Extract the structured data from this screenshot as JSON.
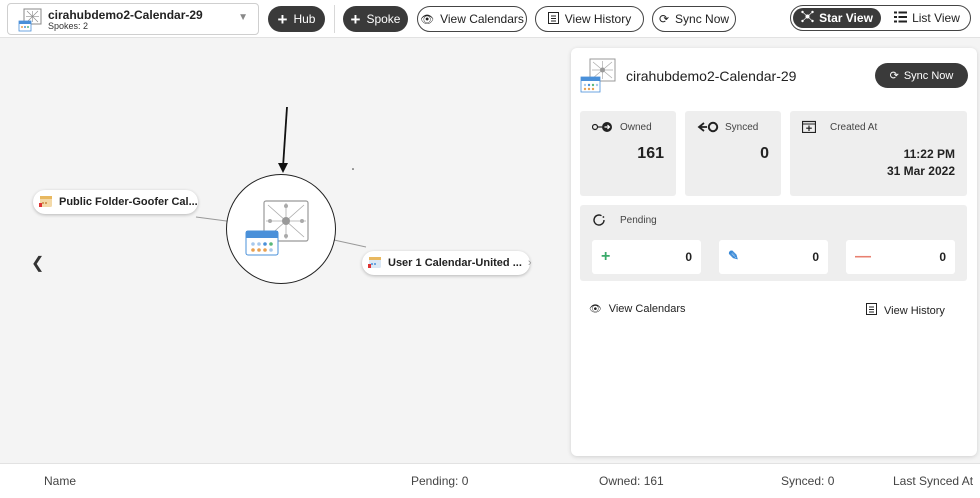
{
  "hub_selector": {
    "name": "cirahubdemo2-Calendar-29",
    "subtitle": "Spokes: 2"
  },
  "toolbar": {
    "hub_label": "Hub",
    "spoke_label": "Spoke",
    "view_calendars_label": "View Calendars",
    "view_history_label": "View History",
    "sync_now_label": "Sync Now",
    "star_view_label": "Star View",
    "list_view_label": "List View"
  },
  "graph": {
    "left_node_label": "Public Folder-Goofer Cal...",
    "right_node_label": "User 1 Calendar-United ..."
  },
  "panel": {
    "title": "cirahubdemo2-Calendar-29",
    "sync_now_label": "Sync Now",
    "owned_label": "Owned",
    "owned_value": "161",
    "synced_label": "Synced",
    "synced_value": "0",
    "created_label": "Created At",
    "created_time": "11:22 PM",
    "created_date": "31 Mar 2022",
    "pending_label": "Pending",
    "pending_add": "0",
    "pending_edit": "0",
    "pending_remove": "0",
    "view_calendars_label": "View Calendars",
    "view_history_label": "View History"
  },
  "list_bar": {
    "name": "Name",
    "pending": "Pending: 0",
    "owned": "Owned: 161",
    "synced": "Synced: 0",
    "last_synced": "Last Synced At"
  },
  "colors": {
    "accent_dark": "#3a3a3a",
    "add_green": "#3aaa6a",
    "edit_blue": "#3a8ad8",
    "remove_red": "#e88070"
  }
}
